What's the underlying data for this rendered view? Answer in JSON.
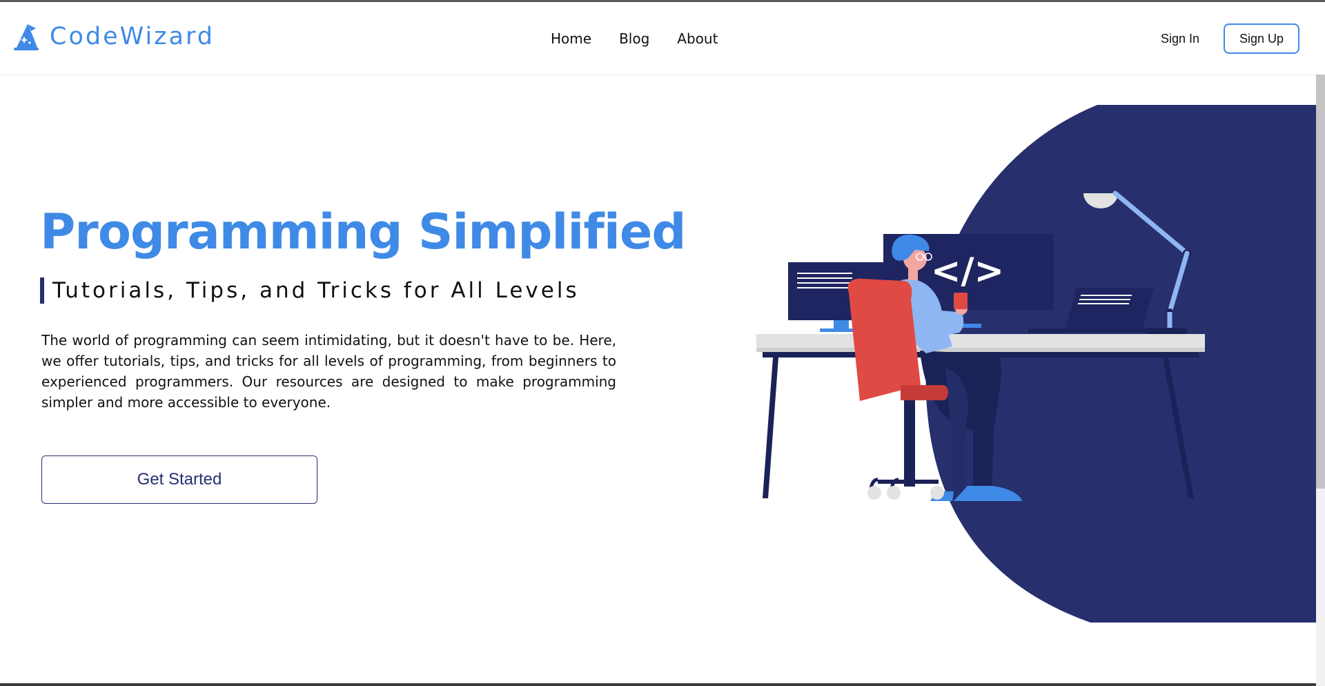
{
  "brand": {
    "name": "CodeWizard",
    "icon": "wizard-hat-icon",
    "color": "#3f8ae6"
  },
  "nav": {
    "items": [
      {
        "label": "Home"
      },
      {
        "label": "Blog"
      },
      {
        "label": "About"
      }
    ]
  },
  "auth": {
    "sign_in": "Sign In",
    "sign_up": "Sign Up"
  },
  "hero": {
    "title": "Programming Simplified",
    "subtitle": "Tutorials, Tips, and Tricks for All Levels",
    "description": "The world of programming can seem intimidating, but it doesn't have to be. Here, we offer tutorials, tips, and tricks for all levels of programming, from beginners to experienced programmers. Our resources are designed to make programming simpler and more accessible to everyone.",
    "cta": "Get Started"
  },
  "illustration": {
    "screen_text": "</>",
    "background_color": "#27306d",
    "accent_color": "#3f8ae6",
    "chair_color": "#e04a44"
  }
}
